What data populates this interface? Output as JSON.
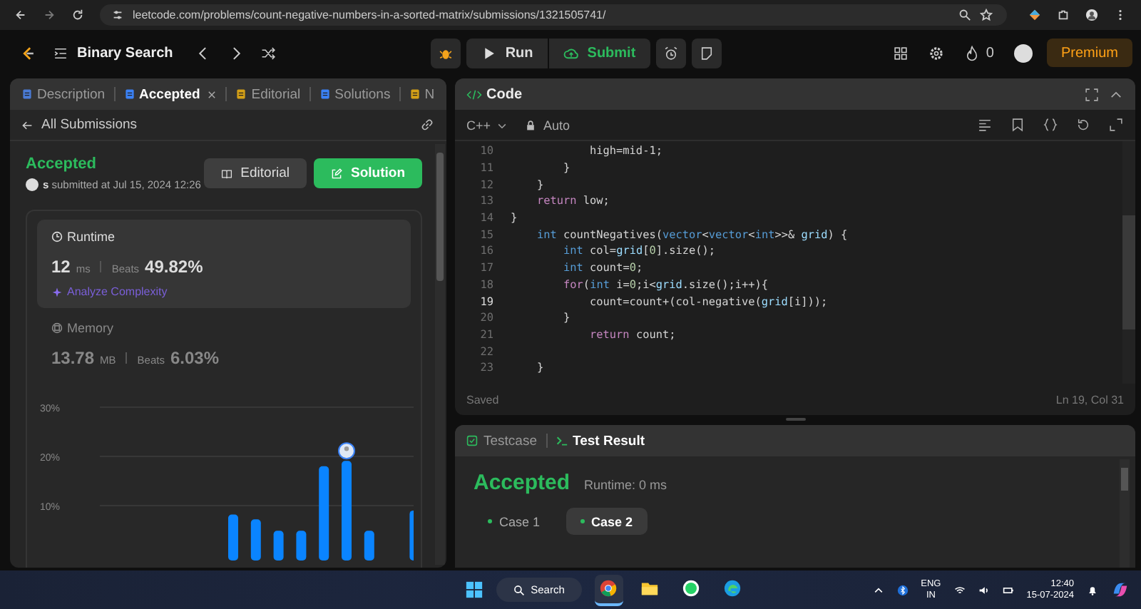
{
  "browser": {
    "url": "leetcode.com/problems/count-negative-numbers-in-a-sorted-matrix/submissions/1321505741/"
  },
  "header": {
    "problem_list": "Binary Search",
    "run": "Run",
    "submit": "Submit",
    "streak": "0",
    "premium": "Premium"
  },
  "left_panel": {
    "tabs": [
      {
        "label": "Description",
        "kind": "description",
        "selected": false,
        "closable": false
      },
      {
        "label": "Accepted",
        "kind": "accepted",
        "selected": true,
        "closable": true
      },
      {
        "label": "Editorial",
        "kind": "editorial",
        "selected": false,
        "closable": false
      },
      {
        "label": "Solutions",
        "kind": "solutions",
        "selected": false,
        "closable": false
      },
      {
        "label": "N",
        "kind": "note",
        "selected": false,
        "closable": false
      }
    ],
    "back_link": "All Submissions",
    "submission": {
      "status": "Accepted",
      "user": "s",
      "submitted": "submitted at Jul 15, 2024 12:26",
      "editorial_button": "Editorial",
      "solution_button": "Solution"
    },
    "metrics": [
      {
        "kind": "runtime",
        "title": "Runtime",
        "value": "12",
        "unit": "ms",
        "beats_label": "Beats",
        "beats": "49.82%",
        "analyze": "Analyze Complexity",
        "selected": true
      },
      {
        "kind": "memory",
        "title": "Memory",
        "value": "13.78",
        "unit": "MB",
        "beats_label": "Beats",
        "beats": "6.03%",
        "selected": false
      }
    ],
    "chart_data": {
      "type": "bar",
      "values": [
        0,
        0,
        0,
        0,
        0,
        8.2,
        7.2,
        4.9,
        4.9,
        18,
        19.1,
        4.9,
        0,
        9
      ],
      "ylim": [
        0,
        30
      ],
      "yticks": [
        {
          "value": 10,
          "label": "10%"
        },
        {
          "value": 20,
          "label": "20%"
        },
        {
          "value": 30,
          "label": "30%"
        }
      ]
    }
  },
  "code_panel": {
    "title": "Code",
    "language": "C++",
    "mode": "Auto",
    "lines": [
      {
        "number": "10",
        "current": false,
        "tokens": [
          {
            "text": "            high=mid-1;",
            "kind": "plain"
          }
        ]
      },
      {
        "number": "11",
        "current": false,
        "tokens": [
          {
            "text": "        }",
            "kind": "plain"
          }
        ]
      },
      {
        "number": "12",
        "current": false,
        "tokens": [
          {
            "text": "    }",
            "kind": "plain"
          }
        ]
      },
      {
        "number": "13",
        "current": false,
        "tokens": [
          {
            "text": "    return",
            "kind": "keyword"
          },
          {
            "text": " low;",
            "kind": "plain"
          }
        ]
      },
      {
        "number": "14",
        "current": false,
        "tokens": [
          {
            "text": "}",
            "kind": "plain"
          }
        ]
      },
      {
        "number": "15",
        "current": false,
        "tokens": [
          {
            "text": "    int",
            "kind": "type"
          },
          {
            "text": " countNegatives(",
            "kind": "plain"
          },
          {
            "text": "vector",
            "kind": "type"
          },
          {
            "text": "<",
            "kind": "plain"
          },
          {
            "text": "vector",
            "kind": "type"
          },
          {
            "text": "<",
            "kind": "plain"
          },
          {
            "text": "int",
            "kind": "type"
          },
          {
            "text": ">>& ",
            "kind": "plain"
          },
          {
            "text": "grid",
            "kind": "variable"
          },
          {
            "text": ") {",
            "kind": "plain"
          }
        ]
      },
      {
        "number": "16",
        "current": false,
        "tokens": [
          {
            "text": "        int",
            "kind": "type"
          },
          {
            "text": " col=",
            "kind": "plain"
          },
          {
            "text": "grid",
            "kind": "variable"
          },
          {
            "text": "[",
            "kind": "plain"
          },
          {
            "text": "0",
            "kind": "number"
          },
          {
            "text": "].size();",
            "kind": "plain"
          }
        ]
      },
      {
        "number": "17",
        "current": false,
        "tokens": [
          {
            "text": "        int",
            "kind": "type"
          },
          {
            "text": " count=",
            "kind": "plain"
          },
          {
            "text": "0",
            "kind": "number"
          },
          {
            "text": ";",
            "kind": "plain"
          }
        ]
      },
      {
        "number": "18",
        "current": false,
        "tokens": [
          {
            "text": "        for",
            "kind": "keyword"
          },
          {
            "text": "(",
            "kind": "plain"
          },
          {
            "text": "int",
            "kind": "type"
          },
          {
            "text": " i=",
            "kind": "plain"
          },
          {
            "text": "0",
            "kind": "number"
          },
          {
            "text": ";i<",
            "kind": "plain"
          },
          {
            "text": "grid",
            "kind": "variable"
          },
          {
            "text": ".size();i++){",
            "kind": "plain"
          }
        ]
      },
      {
        "number": "19",
        "current": true,
        "tokens": [
          {
            "text": "            count=count+(col-negative(",
            "kind": "plain"
          },
          {
            "text": "grid",
            "kind": "variable"
          },
          {
            "text": "[i]));",
            "kind": "plain"
          }
        ]
      },
      {
        "number": "20",
        "current": false,
        "tokens": [
          {
            "text": "        }",
            "kind": "plain"
          }
        ]
      },
      {
        "number": "21",
        "current": false,
        "tokens": [
          {
            "text": "            return",
            "kind": "keyword"
          },
          {
            "text": " count;",
            "kind": "plain"
          }
        ]
      },
      {
        "number": "22",
        "current": false
      },
      {
        "number": "23",
        "current": false,
        "tokens": [
          {
            "text": "    }",
            "kind": "plain"
          }
        ]
      }
    ],
    "status": "Saved",
    "cursor": "Ln 19, Col 31"
  },
  "test_panel": {
    "tabs": [
      {
        "label": "Testcase",
        "kind": "testcase",
        "selected": false
      },
      {
        "label": "Test Result",
        "kind": "result",
        "selected": true
      }
    ],
    "status": "Accepted",
    "runtime": "Runtime: 0 ms",
    "cases": [
      {
        "label": "Case 1",
        "passed": true,
        "selected": false
      },
      {
        "label": "Case 2",
        "passed": true,
        "selected": true
      }
    ]
  },
  "taskbar": {
    "search": "Search",
    "apps": [
      {
        "kind": "chrome",
        "active": true
      },
      {
        "kind": "files",
        "active": false
      },
      {
        "kind": "whatsapp",
        "active": false
      },
      {
        "kind": "edge",
        "active": false
      }
    ],
    "language": "ENG",
    "region": "IN",
    "time": "12:40",
    "date": "15-07-2024"
  }
}
